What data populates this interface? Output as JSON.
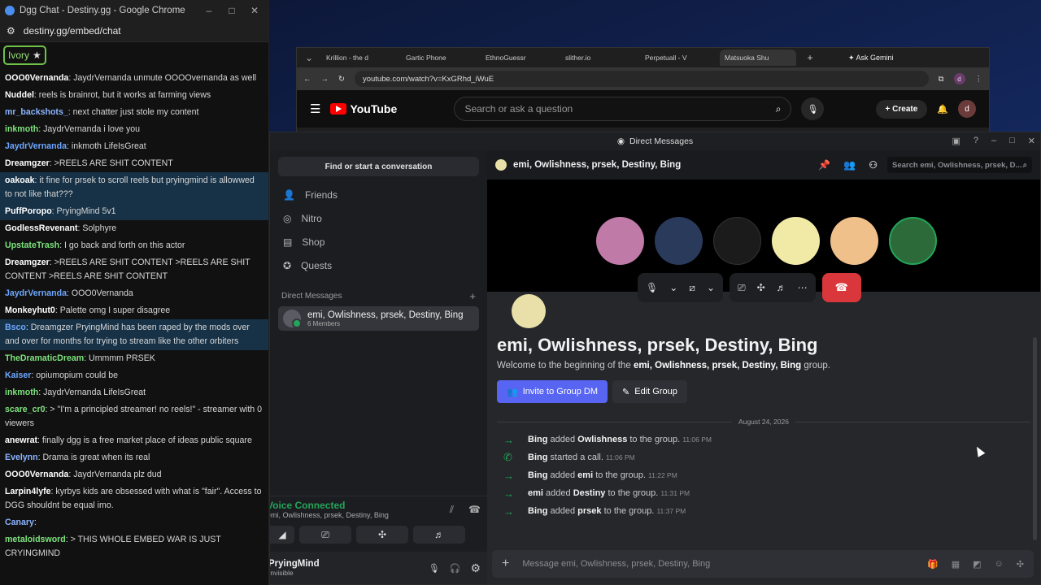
{
  "chat_window": {
    "title": "Dgg Chat - Destiny.gg - Google Chrome",
    "url": "destiny.gg/embed/chat",
    "tag": "Ivory",
    "colors": {
      "accent": "#6fc14a"
    },
    "messages": [
      {
        "user": "OOO0Vernanda",
        "text": ": JaydrVernanda unmute OOOOvernanda as well",
        "color": "#ffffff",
        "hl": false
      },
      {
        "user": "Nuddel",
        "text": ": reels is brainrot, but it works at farming views",
        "color": "#ffffff",
        "hl": false
      },
      {
        "user": "mr_backshots_",
        "text": ": next chatter just stole my content",
        "color": "#8ab4ff",
        "hl": false
      },
      {
        "user": "inkmoth",
        "text": ": JaydrVernanda i love you",
        "color": "#7de37d",
        "hl": false
      },
      {
        "user": "JaydrVernanda",
        "text": ": inkmoth LifeIsGreat",
        "color": "#6ea7ff",
        "hl": false
      },
      {
        "user": "Dreamgzer",
        "text": ": >REELS ARE SHIT CONTENT",
        "color": "#ffffff",
        "hl": false
      },
      {
        "user": "oakoak",
        "text": ": it fine for prsek to scroll reels but pryingmind is allowwed to not like that???",
        "color": "#ffffff",
        "hl": true
      },
      {
        "user": "PuffPoropo",
        "text": ": PryingMind 5v1",
        "color": "#ffffff",
        "hl": true
      },
      {
        "user": "GodlessRevenant",
        "text": ": Solphyre",
        "color": "#ffffff",
        "hl": false
      },
      {
        "user": "UpstateTrash",
        "text": ": I go back and forth on this actor",
        "color": "#7de37d",
        "hl": false
      },
      {
        "user": "Dreamgzer",
        "text": ": >REELS ARE SHIT CONTENT >REELS ARE SHIT CONTENT >REELS ARE SHIT CONTENT",
        "color": "#ffffff",
        "hl": false
      },
      {
        "user": "JaydrVernanda",
        "text": ": OOO0Vernanda",
        "color": "#6ea7ff",
        "hl": false
      },
      {
        "user": "Monkeyhut0",
        "text": ": Palette omg I super disagree",
        "color": "#ffffff",
        "hl": false
      },
      {
        "user": "Bsco",
        "text": ": Dreamgzer PryingMind has been raped by the mods over and over for months for trying to stream like the other orbiters",
        "color": "#6ea7ff",
        "hl": true
      },
      {
        "user": "TheDramaticDream",
        "text": ": Ummmm PRSEK",
        "color": "#7de37d",
        "hl": false
      },
      {
        "user": "Kaiser",
        "text": ": opiumopium could be",
        "color": "#6ea7ff",
        "hl": false
      },
      {
        "user": "inkmoth",
        "text": ": JaydrVernanda LifeIsGreat",
        "color": "#7de37d",
        "hl": false
      },
      {
        "user": "scare_cr0",
        "text": ": > \"I'm a principled streamer! no reels!\" - streamer with 0 viewers",
        "color": "#7de37d",
        "hl": false
      },
      {
        "user": "anewrat",
        "text": ": finally dgg is a free market place of ideas public square",
        "color": "#ffffff",
        "hl": false
      },
      {
        "user": "Evelynn",
        "text": ": Drama is great when its real",
        "color": "#8ab4ff",
        "hl": false
      },
      {
        "user": "OOO0Vernanda",
        "text": ": JaydrVernanda plz dud",
        "color": "#ffffff",
        "hl": false
      },
      {
        "user": "Larpin4lyfe",
        "text": ": kyrbys kids are obsessed with what is \"fair\". Access to DGG shouldnt be equal imo.",
        "color": "#ffffff",
        "hl": false
      },
      {
        "user": "Canary",
        "text": ":",
        "color": "#8ab4ff",
        "hl": false
      },
      {
        "user": "metaloidsword",
        "text": ": > THIS WHOLE EMBED WAR IS JUST CRYINGMIND",
        "color": "#7de37d",
        "hl": false
      }
    ]
  },
  "browser": {
    "tabs": [
      "Krillion - the d",
      "Gartic Phone",
      "EthnoGuessr",
      "slither.io",
      "Perpetuall - V",
      "Matsuoka Shu"
    ],
    "gemini": "Ask Gemini",
    "url": "youtube.com/watch?v=KxGRhd_iWuE",
    "yt_logo": "YouTube",
    "yt_search_placeholder": "Search or ask a question",
    "yt_create": "Create",
    "avatar_letter": "d"
  },
  "discord": {
    "window_title": "Direct Messages",
    "find": "Find or start a conversation",
    "nav": [
      {
        "label": "Friends",
        "icon": "friends-icon"
      },
      {
        "label": "Nitro",
        "icon": "nitro-icon"
      },
      {
        "label": "Shop",
        "icon": "shop-icon"
      },
      {
        "label": "Quests",
        "icon": "quests-icon"
      }
    ],
    "dm_header": "Direct Messages",
    "dm_name": "emi, Owlishness, prsek, Destiny, Bing",
    "dm_members": "6 Members",
    "voice_status": "Voice Connected",
    "voice_channel": "emi, Owlishness, prsek, Destiny, Bing",
    "username": "PryingMind",
    "user_status": "Invisible",
    "header_title": "emi, Owlishness, prsek, Destiny, Bing",
    "search_placeholder": "Search emi, Owlishness, prsek, D...",
    "avatar_colors": [
      "#c07aa8",
      "#2a3a5a",
      "#1b1b1b",
      "#f1eaa6",
      "#f0c08a",
      "#2c6a3a"
    ],
    "group_title": "emi, Owlishness, prsek, Destiny, Bing",
    "welcome_pre": "Welcome to the beginning of the",
    "welcome_name": "emi, Owlishness, prsek, Destiny, Bing",
    "welcome_post": "group.",
    "invite_button": "Invite to Group DM",
    "edit_button": "Edit Group",
    "date": "August 24, 2026",
    "system_messages": [
      {
        "actor": "Bing",
        "action": "added",
        "target": "Owlishness",
        "post": "to the group.",
        "time": "11:06 PM",
        "icon": "→"
      },
      {
        "actor": "Bing",
        "action": "started a call.",
        "target": "",
        "post": "",
        "time": "11:06 PM",
        "icon": "✆"
      },
      {
        "actor": "Bing",
        "action": "added",
        "target": "emi",
        "post": "to the group.",
        "time": "11:22 PM",
        "icon": "→"
      },
      {
        "actor": "emi",
        "action": "added",
        "target": "Destiny",
        "post": "to the group.",
        "time": "11:31 PM",
        "icon": "→"
      },
      {
        "actor": "Bing",
        "action": "added",
        "target": "prsek",
        "post": "to the group.",
        "time": "11:37 PM",
        "icon": "→"
      }
    ],
    "message_placeholder": "Message emi, Owlishness, prsek, Destiny, Bing",
    "colors": {
      "blurple": "#5865f2",
      "green": "#23a55a",
      "red": "#da373c"
    }
  }
}
